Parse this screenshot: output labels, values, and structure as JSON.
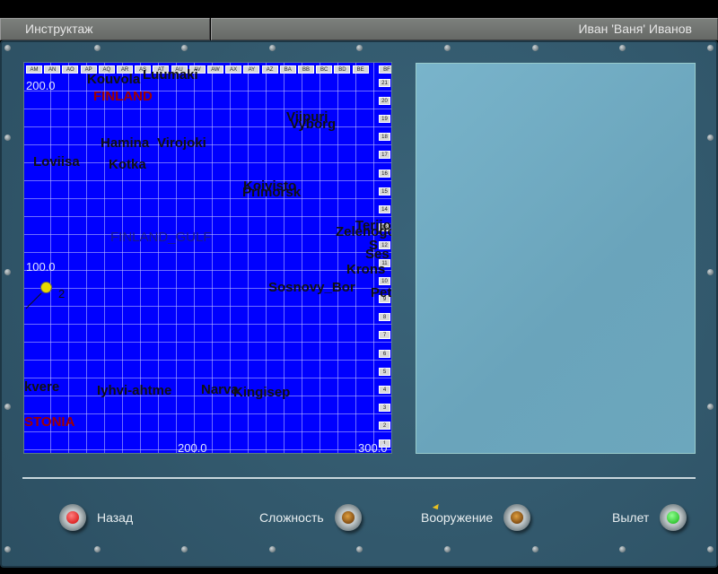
{
  "header": {
    "title": "Инструктаж",
    "user": "Иван 'Ваня' Иванов"
  },
  "map": {
    "columns": [
      "AM",
      "AN",
      "AO",
      "AP",
      "AQ",
      "AR",
      "AS",
      "AT",
      "AU",
      "AV",
      "AW",
      "AX",
      "AY",
      "AZ",
      "BA",
      "BB",
      "BC",
      "BD",
      "BE",
      "BF"
    ],
    "rows": [
      "21",
      "20",
      "19",
      "18",
      "17",
      "16",
      "15",
      "14",
      "13",
      "12",
      "11",
      "10",
      "9",
      "8",
      "7",
      "6",
      "5",
      "4",
      "3",
      "2",
      "1"
    ],
    "coords": {
      "y200": "200.0",
      "y100": "100.0",
      "x200": "200.0",
      "x300": "300.0"
    },
    "labels": {
      "kouvola": "Kouvola",
      "luumaki": "Luumaki",
      "finland": "FINLAND",
      "viipuri": "Viipuri",
      "vyborg": "Vyborg",
      "hamina": "Hamina",
      "virojoki": "Virojoki",
      "loviisa": "Loviisa",
      "kotka": "Kotka",
      "koivisto": "Koivisto",
      "primorsk": "Primorsk",
      "gulf": "FINLAND_GULF",
      "terijoki": "Terijoki",
      "zelenogorsk": "Zelenogorsk",
      "s1": "S",
      "ses": "Ses",
      "krons": "Krons",
      "sosnovy": "Sosnovy_Bor",
      "pet": "Pet",
      "rakvere": "kvere",
      "iyhvi": "Iyhvi-ahtme",
      "narva": "Narva",
      "kingisep": "Kingisep",
      "estonia": "STONIA"
    },
    "waypoint": {
      "label": "2",
      "color": "#e8d800"
    }
  },
  "buttons": {
    "back": "Назад",
    "difficulty": "Сложность",
    "weapons": "Вооружение",
    "launch": "Вылет"
  },
  "colors": {
    "back": "#e01010",
    "difficulty": "#7a3a00",
    "weapons": "#7a3a00",
    "launch": "#20d020"
  }
}
